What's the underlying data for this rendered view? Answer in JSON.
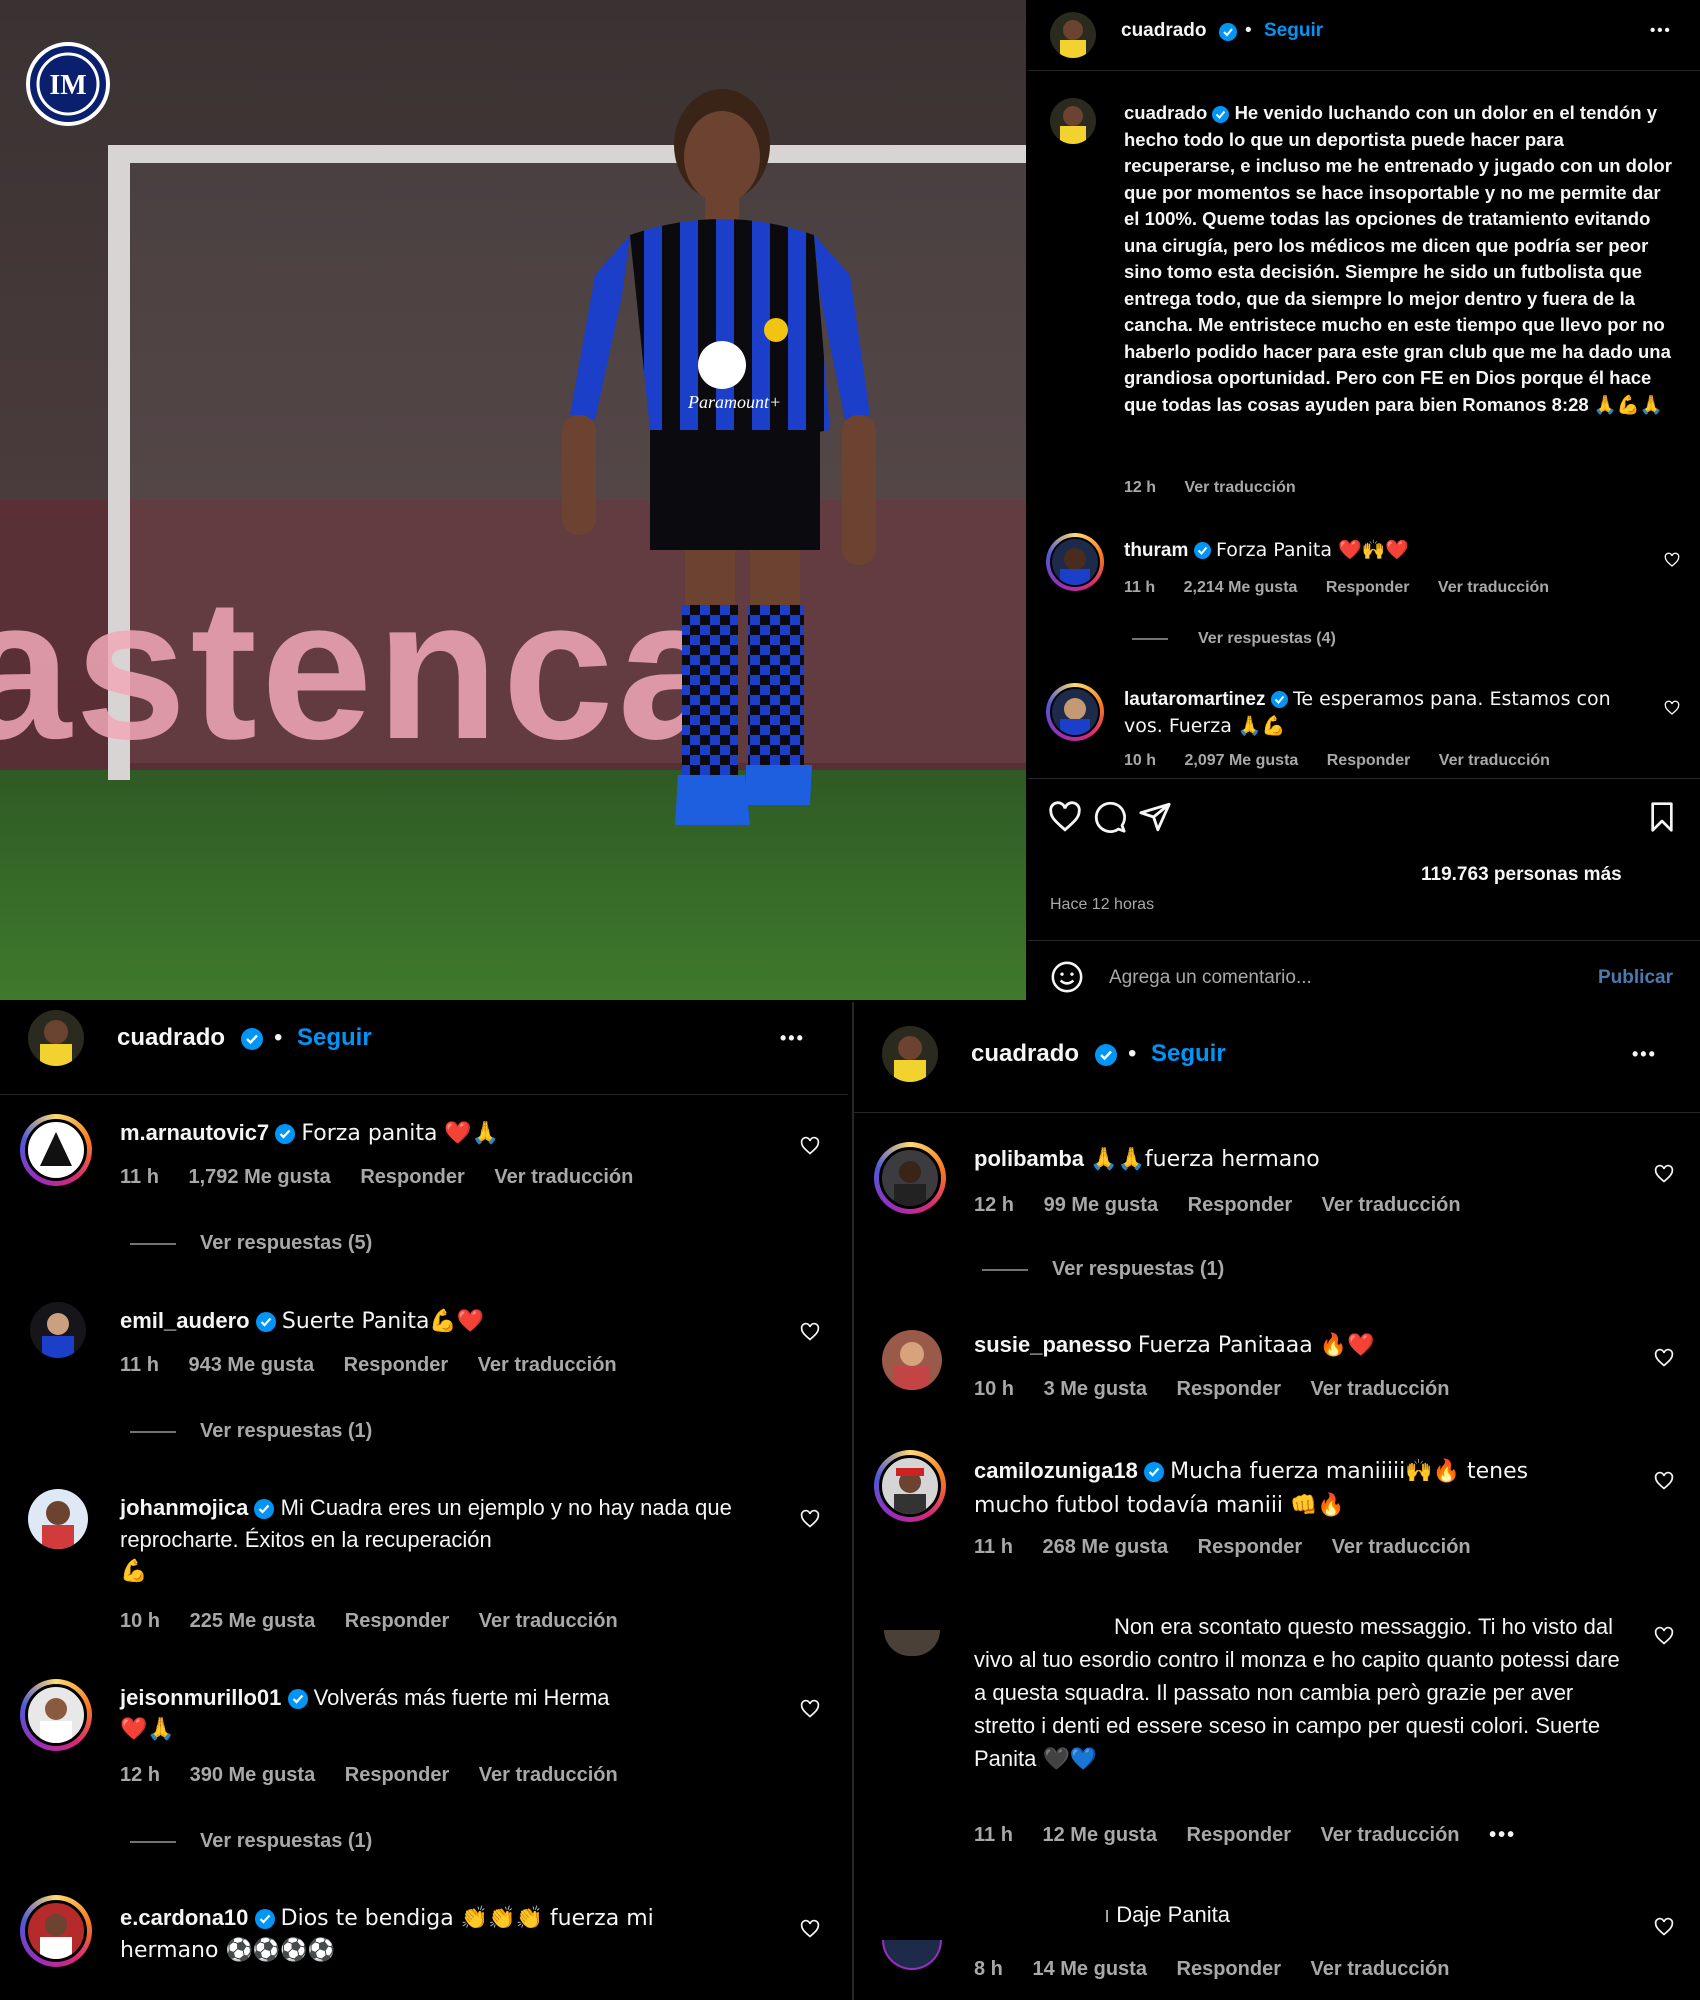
{
  "post": {
    "username": "cuadrado",
    "follow_label": "Seguir",
    "more_label": "•••",
    "caption_user": "cuadrado",
    "caption_text": "He venido luchando con un dolor en el tendón y hecho todo lo que un deportista puede hacer para recuperarse, e incluso me he entrenado y jugado con un dolor que por momentos se hace insoportable y no me permite dar el 100%. Queme todas las opciones de tratamiento evitando una cirugía, pero los médicos me dicen que podría ser peor sino tomo esta decisión. Siempre he sido un futbolista que entrega todo, que da siempre lo mejor dentro y fuera de la cancha. Me entristece mucho en este tiempo que llevo por no haberlo podido hacer para este gran club que me ha dado una grandiosa oportunidad. Pero con FE en Dios porque él hace que todas las cosas ayuden para bien Romanos 8:28 🙏💪🙏",
    "caption_time": "12 h",
    "caption_translate": "Ver traducción",
    "likes_text": "119.763 personas más",
    "time_ago": "Hace 12 horas",
    "comment_placeholder": "Agrega un comentario...",
    "publish_label": "Publicar",
    "photo_bg_text": "astenca",
    "jersey_sponsor": "Paramount+",
    "colors": {
      "accent": "#0095f6",
      "inter_blue": "#0a5ed7",
      "heart": "#ff3040"
    }
  },
  "top_comments": [
    {
      "user": "thuram",
      "text": "Forza Panita ❤️🙌❤️",
      "time": "11 h",
      "likes": "2,214 Me gusta",
      "reply": "Responder",
      "translate": "Ver traducción",
      "replies": "Ver respuestas (4)"
    },
    {
      "user": "lautaromartinez",
      "text": "Te esperamos pana. Estamos con vos. Fuerza 🙏💪",
      "time": "10 h",
      "likes": "2,097 Me gusta",
      "reply": "Responder",
      "translate": "Ver traducción"
    }
  ],
  "left_panel": {
    "username": "cuadrado",
    "follow_label": "Seguir",
    "more_label": "•••",
    "comments": [
      {
        "user": "m.arnautovic7",
        "text": "Forza panita ❤️🙏",
        "time": "11 h",
        "likes": "1,792 Me gusta",
        "reply": "Responder",
        "translate": "Ver traducción",
        "replies": "Ver respuestas (5)"
      },
      {
        "user": "emil_audero",
        "text": "Suerte Panita💪❤️",
        "time": "11 h",
        "likes": "943 Me gusta",
        "reply": "Responder",
        "translate": "Ver traducción",
        "replies": "Ver respuestas (1)"
      },
      {
        "user": "johanmojica",
        "text": "Mi Cuadra eres un ejemplo y no hay nada que reprocharte. Éxitos en la recuperación",
        "text2": "💪",
        "time": "10 h",
        "likes": "225 Me gusta",
        "reply": "Responder",
        "translate": "Ver traducción"
      },
      {
        "user": "jeisonmurillo01",
        "text": "Volverás más fuerte mi Herma",
        "text2": "❤️🙏",
        "time": "12 h",
        "likes": "390 Me gusta",
        "reply": "Responder",
        "translate": "Ver traducción",
        "replies": "Ver respuestas (1)"
      },
      {
        "user": "e.cardona10",
        "text": "Dios te bendiga 👏👏👏 fuerza mi",
        "text2": "hermano ⚽⚽⚽⚽"
      }
    ]
  },
  "right_panel": {
    "username": "cuadrado",
    "follow_label": "Seguir",
    "more_label": "•••",
    "comments": [
      {
        "user": "polibamba",
        "text": "🙏🙏fuerza hermano",
        "time": "12 h",
        "likes": "99 Me gusta",
        "reply": "Responder",
        "translate": "Ver traducción",
        "replies": "Ver respuestas (1)"
      },
      {
        "user": "susie_panesso",
        "text": "Fuerza Panitaaa 🔥❤️",
        "time": "10 h",
        "likes": "3 Me gusta",
        "reply": "Responder",
        "translate": "Ver traducción"
      },
      {
        "user": "camilozuniga18",
        "text": "Mucha fuerza maniiiii🙌🔥 tenes",
        "text2": "mucho futbol todavía maniii 👊🔥",
        "time": "11 h",
        "likes": "268 Me gusta",
        "reply": "Responder",
        "translate": "Ver traducción"
      },
      {
        "text": "Non era scontato questo messaggio. Ti ho visto dal vivo al tuo esordio contro il monza e ho capito quanto potessi dare a questa squadra. Il passato non cambia però grazie per aver stretto i denti ed essere sceso in campo per questi colori. Suerte Panita 🖤💙",
        "time": "11 h",
        "likes": "12 Me gusta",
        "reply": "Responder",
        "translate": "Ver traducción",
        "more": "•••"
      },
      {
        "text": "Daje Panita",
        "time": "8 h",
        "likes": "14 Me gusta",
        "reply": "Responder",
        "translate": "Ver traducción"
      }
    ]
  }
}
